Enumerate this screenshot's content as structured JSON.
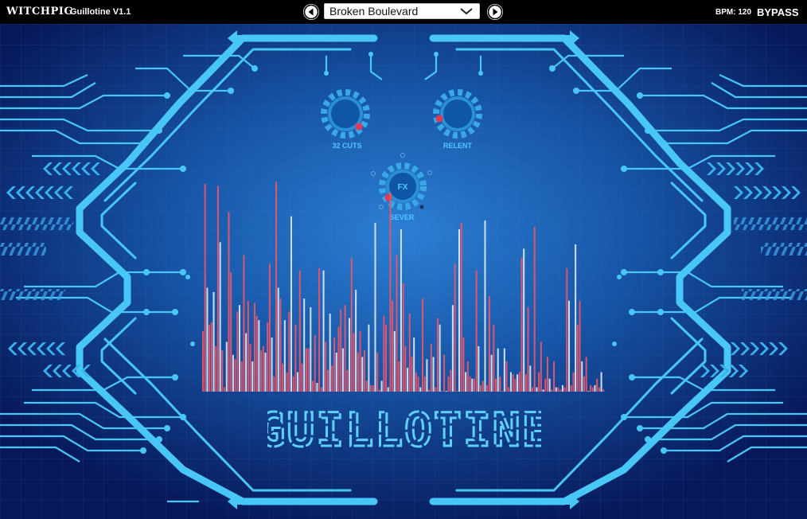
{
  "header": {
    "brand": "WITCHPIG",
    "product": "Guillotine V1.1",
    "preset_name": "Broken Boulevard",
    "bpm_label": "BPM: 120",
    "bypass_label": "BYPASS"
  },
  "knobs": {
    "cuts_label": "32 CUTS",
    "relent_label": "RELENT",
    "fx_label": "FX",
    "sever_label": "SEVER"
  },
  "logo_text": "GUILLOTINE",
  "colors": {
    "bg_center": "#2470c4",
    "bg_edge": "#06144a",
    "accent": "#46c4f4",
    "knob_dot": "#e23a54",
    "bar_red": "#e7566a",
    "bar_white": "#d6e6f2"
  },
  "visualizer": {
    "bars": [
      0.28,
      0.96,
      0.48,
      0.31,
      0.32,
      0.46,
      0.21,
      0.95,
      0.69,
      0.19,
      0.02,
      0.23,
      0.83,
      0.55,
      0.17,
      0.15,
      0.37,
      0.4,
      0.14,
      0.63,
      0.27,
      0.42,
      0.22,
      0.14,
      0.41,
      0.35,
      0.33,
      0.19,
      0.21,
      0.18,
      0.32,
      0.59,
      0.25,
      0.07,
      0.97,
      0.48,
      0.43,
      0.13,
      0.33,
      0.09,
      0.37,
      0.81,
      0.07,
      0.31,
      0.09,
      0.56,
      0.13,
      0.43,
      0.2,
      0.2,
      0.39,
      0.05,
      0.26,
      0.04,
      0.57,
      0.02,
      0.56,
      0.23,
      0.1,
      0.36,
      0.12,
      0.25,
      0.18,
      0.3,
      0.38,
      0.2,
      0.4,
      0.1,
      0.34,
      0.62,
      0.27,
      0.47,
      0.18,
      0.28,
      0.16,
      0.19,
      0.05,
      0.31,
      0.03,
      0.03,
      0.78,
      0.18,
      0.01,
      0.05,
      0.35,
      0.31,
      0.02,
      0.92,
      0.42,
      0.28,
      0.63,
      0.14,
      0.75,
      0.5,
      0.21,
      0.11,
      0.36,
      0.16,
      0.25,
      0.09,
      0.07,
      0.02,
      0.43,
      0.07,
      0.15,
      0.01,
      0.22,
      0.16,
      0.02,
      0.34,
      0.31,
      0.0,
      0.17,
      0.0,
      0.07,
      0.1,
      0.4,
      0.59,
      0.0,
      0.75,
      0.78,
      0.25,
      0.09,
      0.14,
      0.07,
      0.06,
      0.06,
      0.56,
      0.21,
      0.03,
      0.05,
      0.79,
      0.03,
      0.44,
      0.17,
      0.31,
      0.06,
      0.2,
      0.07,
      0.0,
      0.2,
      0.14,
      0.02,
      0.09,
      0.08,
      0.06,
      0.08,
      0.09,
      0.62,
      0.66,
      0.08,
      0.39,
      0.12,
      0.02,
      0.76,
      0.02,
      0.09,
      0.23,
      0.01,
      0.06,
      0.16,
      0.06,
      0.01,
      0.14,
      0.02,
      0.02,
      0.01,
      0.03,
      0.02,
      0.57,
      0.42,
      0.03,
      0.09,
      0.68,
      0.31,
      0.42,
      0.14,
      0.07,
      0.16,
      0.0,
      0.03,
      0.02,
      0.03,
      0.06,
      0.02,
      0.09,
      0.01
    ]
  }
}
